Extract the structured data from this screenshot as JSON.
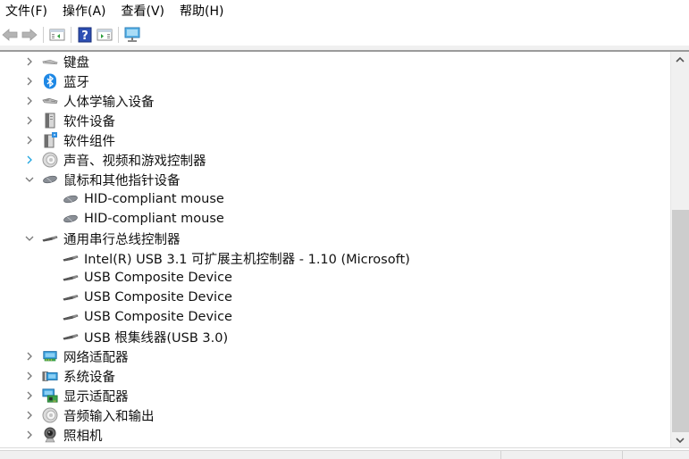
{
  "menubar": {
    "items": [
      {
        "label": "文件(F)"
      },
      {
        "label": "操作(A)"
      },
      {
        "label": "查看(V)"
      },
      {
        "label": "帮助(H)"
      }
    ]
  },
  "toolbar": {
    "buttons": [
      {
        "name": "back",
        "icon": "back-arrow-icon",
        "enabled": false
      },
      {
        "name": "forward",
        "icon": "forward-arrow-icon",
        "enabled": false
      },
      {
        "name": "show-hide-console-tree",
        "icon": "console-tree-icon"
      },
      {
        "name": "help",
        "icon": "help-icon"
      },
      {
        "name": "show-hide-action-pane",
        "icon": "action-pane-icon"
      },
      {
        "name": "scan-hardware",
        "icon": "monitor-icon"
      }
    ]
  },
  "tree": {
    "items": [
      {
        "label": "键盘",
        "level": 1,
        "state": "collapsed",
        "icon": "keyboard-icon"
      },
      {
        "label": "蓝牙",
        "level": 1,
        "state": "collapsed",
        "icon": "bluetooth-icon"
      },
      {
        "label": "人体学输入设备",
        "level": 1,
        "state": "collapsed",
        "icon": "hid-icon"
      },
      {
        "label": "软件设备",
        "level": 1,
        "state": "collapsed",
        "icon": "software-device-icon"
      },
      {
        "label": "软件组件",
        "level": 1,
        "state": "collapsed",
        "icon": "software-component-icon"
      },
      {
        "label": "声音、视频和游戏控制器",
        "level": 1,
        "state": "collapsed",
        "icon": "speaker-icon",
        "hover": true
      },
      {
        "label": "鼠标和其他指针设备",
        "level": 1,
        "state": "expanded",
        "icon": "mouse-icon"
      },
      {
        "label": "HID-compliant mouse",
        "level": 2,
        "icon": "mouse-icon"
      },
      {
        "label": "HID-compliant mouse",
        "level": 2,
        "icon": "mouse-icon"
      },
      {
        "label": "通用串行总线控制器",
        "level": 1,
        "state": "expanded",
        "icon": "usb-icon"
      },
      {
        "label": "Intel(R) USB 3.1 可扩展主机控制器 - 1.10 (Microsoft)",
        "level": 2,
        "icon": "usb-icon"
      },
      {
        "label": "USB Composite Device",
        "level": 2,
        "icon": "usb-icon"
      },
      {
        "label": "USB Composite Device",
        "level": 2,
        "icon": "usb-icon"
      },
      {
        "label": "USB Composite Device",
        "level": 2,
        "icon": "usb-icon"
      },
      {
        "label": "USB 根集线器(USB 3.0)",
        "level": 2,
        "icon": "usb-icon"
      },
      {
        "label": "网络适配器",
        "level": 1,
        "state": "collapsed",
        "icon": "network-adapter-icon"
      },
      {
        "label": "系统设备",
        "level": 1,
        "state": "collapsed",
        "icon": "system-device-icon"
      },
      {
        "label": "显示适配器",
        "level": 1,
        "state": "collapsed",
        "icon": "display-adapter-icon"
      },
      {
        "label": "音频输入和输出",
        "level": 1,
        "state": "collapsed",
        "icon": "audio-io-icon"
      },
      {
        "label": "照相机",
        "level": 1,
        "state": "collapsed",
        "icon": "camera-icon"
      }
    ]
  },
  "scrollbar": {
    "vertical_position_fraction": 0.39,
    "visible_fraction": 0.61
  },
  "colors": {
    "hover_chevron": "#1ea5e0",
    "chevron": "#777777",
    "scrollbar_thumb": "#cdcdcd",
    "scrollbar_track": "#f0f0f0"
  }
}
